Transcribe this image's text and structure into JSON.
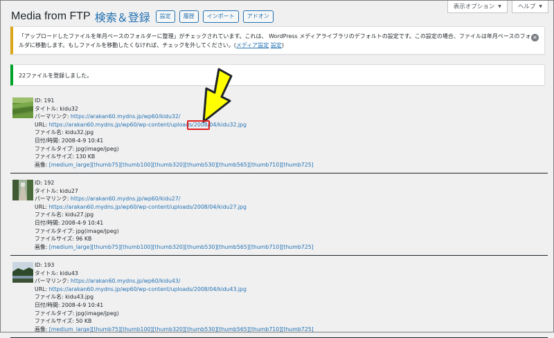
{
  "screen_tabs": {
    "options": "表示オプション",
    "help": "ヘルプ"
  },
  "header": {
    "app_title": "Media from FTP",
    "page_title": "検索＆登録",
    "buttons": [
      "設定",
      "履歴",
      "インポート",
      "アドオン"
    ]
  },
  "notices": {
    "warning": {
      "text": "「アップロードしたファイルを年月ベースのフォルダーに整理」がチェックされています。これは、 WordPress メディアライブラリのデフォルトの設定です。この設定の場合、ファイルは年月ベースのフォルダに移動します。もしファイルを移動したくなければ、チェックを外してください。(",
      "link_media": "メディア設定",
      "link_settings": "設定",
      "suffix": ")"
    },
    "success": {
      "text": "22ファイルを登録しました。"
    }
  },
  "items": [
    {
      "id": "ID: 191",
      "title_label": "タイトル: ",
      "title": "kidu32",
      "permalink_label": "パーマリンク: ",
      "permalink": "https://arakan60.mydns.jp/wp60/kidu32/",
      "url_label": "URL: ",
      "url": "https://arakan60.mydns.jp/wp60/wp-content/uploads/2008/04/kidu32.jpg",
      "filename": "ファイル名: kidu32.jpg",
      "datetime": "日付/時間: 2008-4-9 10:41",
      "filetype": "ファイルタイプ: jpg(image/jpeg)",
      "filesize": "ファイルサイズ: 130 KB",
      "images_label": "画像: ",
      "images": [
        "[medium_large]",
        "[thumb75]",
        "[thumb100]",
        "[thumb320]",
        "[thumb530]",
        "[thumb565]",
        "[thumb710]",
        "[thumb725]"
      ]
    },
    {
      "id": "ID: 192",
      "title_label": "タイトル: ",
      "title": "kidu27",
      "permalink_label": "パーマリンク: ",
      "permalink": "https://arakan60.mydns.jp/wp60/kidu27/",
      "url_label": "URL: ",
      "url": "https://arakan60.mydns.jp/wp60/wp-content/uploads/2008/04/kidu27.jpg",
      "filename": "ファイル名: kidu27.jpg",
      "datetime": "日付/時間: 2008-4-9 10:41",
      "filetype": "ファイルタイプ: jpg(image/jpeg)",
      "filesize": "ファイルサイズ: 96 KB",
      "images_label": "画像: ",
      "images": [
        "[medium_large]",
        "[thumb75]",
        "[thumb100]",
        "[thumb320]",
        "[thumb530]",
        "[thumb565]",
        "[thumb710]",
        "[thumb725]"
      ]
    },
    {
      "id": "ID: 193",
      "title_label": "タイトル: ",
      "title": "kidu43",
      "permalink_label": "パーマリンク: ",
      "permalink": "https://arakan60.mydns.jp/wp60/kidu43/",
      "url_label": "URL: ",
      "url": "https://arakan60.mydns.jp/wp60/wp-content/uploads/2008/04/kidu43.jpg",
      "filename": "ファイル名: kidu43.jpg",
      "datetime": "日付/時間: 2008-4-9 10:41",
      "filetype": "ファイルタイプ: jpg(image/jpeg)",
      "filesize": "ファイルサイズ: 50 KB",
      "images_label": "画像: ",
      "images": [
        "[medium_large]",
        "[thumb75]",
        "[thumb100]",
        "[thumb320]",
        "[thumb530]",
        "[thumb565]",
        "[thumb710]",
        "[thumb725]"
      ]
    }
  ],
  "colors": {
    "link": "#2271b1",
    "warning_border": "#dba617",
    "success_border": "#00a32a",
    "annotation_box": "#e01c1c",
    "annotation_arrow": "#ffff00"
  }
}
